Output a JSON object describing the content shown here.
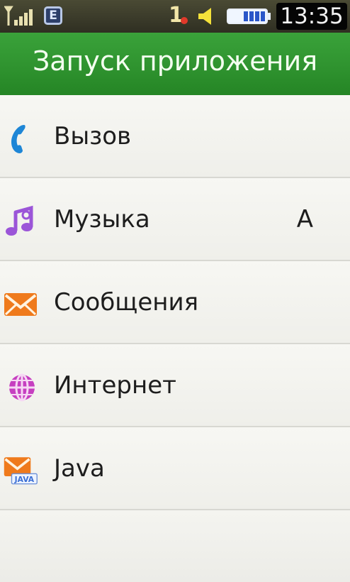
{
  "status_bar": {
    "network_type": "E",
    "sim_number": "1",
    "time": "13:35",
    "icons": [
      "signal-icon",
      "edge-icon",
      "speaker-icon",
      "battery-icon"
    ]
  },
  "header": {
    "title": "Запуск приложения"
  },
  "menu": {
    "items": [
      {
        "label": "Вызов",
        "shortcut": "",
        "icon": "phone-icon",
        "color": "#1e86d6"
      },
      {
        "label": "Музыка",
        "shortcut": "A",
        "icon": "music-note-icon",
        "color": "#9b55d8"
      },
      {
        "label": "Сообщения",
        "shortcut": "",
        "icon": "envelope-icon",
        "color": "#ef7a1c"
      },
      {
        "label": "Интернет",
        "shortcut": "",
        "icon": "globe-icon",
        "color": "#c63fc0"
      },
      {
        "label": "Java",
        "shortcut": "",
        "icon": "java-envelope-icon",
        "color": "#ef7a1c",
        "icon_text": "JAVA"
      }
    ]
  },
  "colors": {
    "header_green": "#2f932f",
    "status_bar": "#3a3a2a",
    "list_background": "#f3f3ef"
  }
}
